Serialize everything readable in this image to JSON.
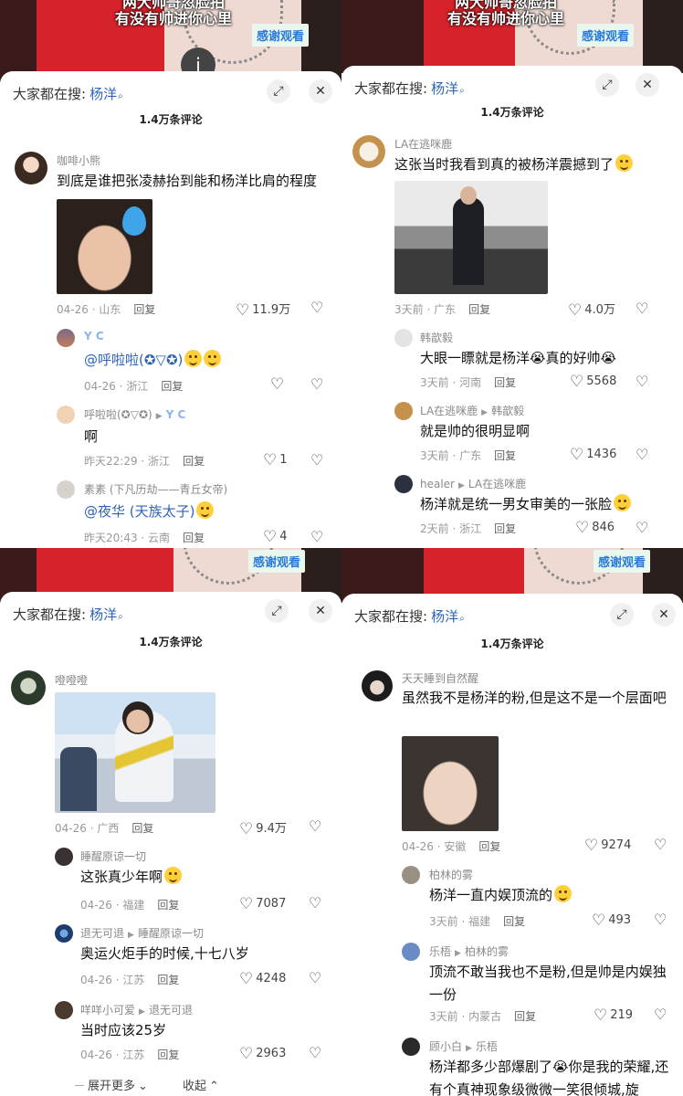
{
  "common": {
    "search_prefix": "大家都在搜:",
    "search_keyword": "杨洋",
    "comment_count": "1.4万条评论",
    "thanks_badge": "感谢观看",
    "subtitle_line1": "两大帅哥忽脸拍",
    "subtitle_line2": "有没有帅进你心里",
    "reply_label": "回复"
  },
  "panel_tl": {
    "comments": [
      {
        "user": "咖啡小熊",
        "text": "到底是谁把张凌赫抬到能和杨洋比肩的程度",
        "date": "04-26",
        "loc": "山东",
        "likes": "11.9万"
      },
      {
        "user": "Y C",
        "text": "@呼啦啦(✪▽✪)",
        "date": "04-26",
        "loc": "浙江",
        "likes": ""
      },
      {
        "user": "呼啦啦(✪▽✪)",
        "to": "Y C",
        "text": "啊",
        "date": "昨天22:29",
        "loc": "浙江",
        "likes": "1"
      },
      {
        "user": "素素 (下凡历劫——青丘女帝)",
        "text": "@夜华 (天族太子)",
        "date": "昨天20:43",
        "loc": "云南",
        "likes": "4"
      }
    ]
  },
  "panel_tr": {
    "comments": [
      {
        "user": "LA在逃咪鹿",
        "text": "这张当时我看到真的被杨洋震撼到了",
        "date": "3天前",
        "loc": "广东",
        "likes": "4.0万"
      },
      {
        "user": "韩歆毅",
        "text": "大眼一瞟就是杨洋😭真的好帅😭",
        "date": "3天前",
        "loc": "河南",
        "likes": "5568"
      },
      {
        "user": "LA在逃咪鹿",
        "to": "韩歆毅",
        "text": "就是帅的很明显啊",
        "date": "3天前",
        "loc": "广东",
        "likes": "1436"
      },
      {
        "user": "healer",
        "to": "LA在逃咪鹿",
        "text": "杨洋就是统一男女审美的一张脸",
        "date": "2天前",
        "loc": "浙江",
        "likes": "846"
      }
    ]
  },
  "panel_bl": {
    "comments": [
      {
        "user": "噔噔噔",
        "text": "",
        "date": "04-26",
        "loc": "广西",
        "likes": "9.4万"
      },
      {
        "user": "睡醒原谅一切",
        "text": "这张真少年啊",
        "date": "04-26",
        "loc": "福建",
        "likes": "7087"
      },
      {
        "user": "退无可退",
        "to": "睡醒原谅一切",
        "text": "奥运火炬手的时候,十七八岁",
        "date": "04-26",
        "loc": "江苏",
        "likes": "4248"
      },
      {
        "user": "咩咩小可爱",
        "to": "退无可退",
        "text": "当时应该25岁",
        "date": "04-26",
        "loc": "江苏",
        "likes": "2963"
      }
    ],
    "expand_more": "展开更多",
    "collapse": "收起"
  },
  "panel_br": {
    "comments": [
      {
        "user": "天天睡到自然醒",
        "text": "虽然我不是杨洋的粉,但是这不是一个层面吧",
        "date": "04-26",
        "loc": "安徽",
        "likes": "9274"
      },
      {
        "user": "柏林的雾",
        "text": "杨洋一直内娱顶流的",
        "date": "3天前",
        "loc": "福建",
        "likes": "493"
      },
      {
        "user": "乐梧",
        "to": "柏林的雾",
        "text": "顶流不敢当我也不是粉,但是帅是内娱独一份",
        "date": "3天前",
        "loc": "内蒙古",
        "likes": "219"
      },
      {
        "user": "顾小白",
        "to": "乐梧",
        "text": "杨洋都多少部爆剧了😭你是我的荣耀,还有个真神现象级微微一笑很倾城,旋",
        "date": "",
        "loc": "",
        "likes": ""
      }
    ]
  },
  "colors": {
    "accent": "#2e64b8",
    "red": "#d6222a"
  }
}
